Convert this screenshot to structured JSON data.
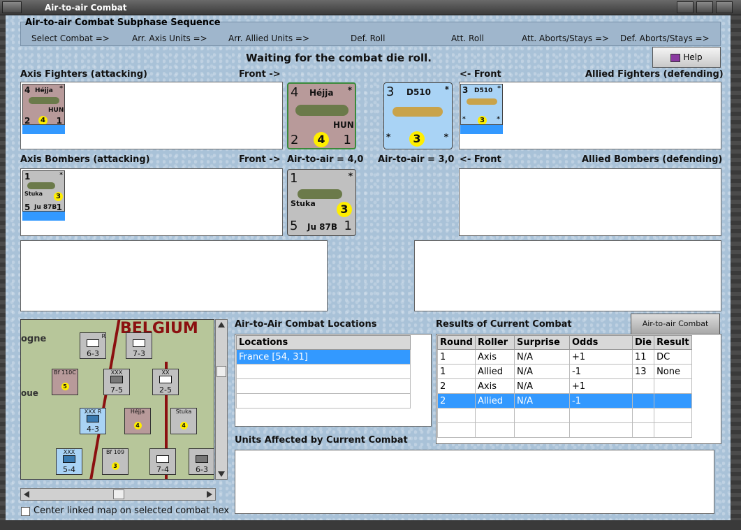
{
  "window": {
    "title": "Air-to-air Combat"
  },
  "phase": {
    "title": "Air-to-air Combat Subphase Sequence",
    "steps": [
      "Select Combat =>",
      "Arr. Axis Units =>",
      "Arr. Allied Units =>",
      "Def. Roll",
      "Att. Roll",
      "Att. Aborts/Stays =>",
      "Def. Aborts/Stays =>"
    ]
  },
  "status": "Waiting for the combat die roll.",
  "help_label": "Help",
  "labels": {
    "axis_fighters": "Axis Fighters (attacking)",
    "axis_bombers": "Axis Bombers (attacking)",
    "allied_fighters": "Allied Fighters (defending)",
    "allied_bombers": "Allied Bombers (defending)",
    "front_right": "Front ->",
    "front_left": "<- Front",
    "axis_air": "Air-to-air = 4,0",
    "allied_air": "Air-to-air = 3,0"
  },
  "counters": {
    "hejja": {
      "tl": "4",
      "name": "Héjja",
      "tr": "*",
      "nat": "HUN",
      "bl": "2",
      "mod": "4",
      "br": "1",
      "color": "#b89a9a"
    },
    "d510": {
      "tl": "3",
      "name": "D510",
      "tr": "*",
      "bl": "*",
      "mod": "3",
      "br": "*",
      "color": "#a9d3f5"
    },
    "stuka": {
      "tl": "1",
      "name": "Stuka",
      "tr": "*",
      "bl": "5",
      "type": "Ju 87B",
      "mod": "3",
      "br": "1",
      "color": "#c0c0c0"
    }
  },
  "locations": {
    "title": "Air-to-Air Combat Locations",
    "header": "Locations",
    "items": [
      "France [54, 31]"
    ]
  },
  "results": {
    "title": "Results of Current Combat",
    "chart_button": "Air-to-air Combat Chart",
    "columns": [
      "Round",
      "Roller",
      "Surprise",
      "Odds",
      "Die",
      "Result"
    ],
    "rows": [
      [
        "1",
        "Axis",
        "N/A",
        "+1",
        "11",
        "DC"
      ],
      [
        "1",
        "Allied",
        "N/A",
        "-1",
        "13",
        "None"
      ],
      [
        "2",
        "Axis",
        "N/A",
        "+1",
        "",
        ""
      ],
      [
        "2",
        "Allied",
        "N/A",
        "-1",
        "",
        ""
      ]
    ]
  },
  "units_affected_title": "Units Affected by Current Combat",
  "map": {
    "label_belgium": "BELGIUM",
    "label_ogne": "ogne",
    "label_oue": "oue",
    "units": [
      {
        "top": "R",
        "val": "6-3",
        "color": "#c0c0c0"
      },
      {
        "top": "",
        "val": "7-3",
        "color": "#c0c0c0"
      },
      {
        "top": "XXX",
        "val": "7-5",
        "color": "#c0c0c0"
      },
      {
        "top": "XX",
        "val": "2-5",
        "color": "#c0c0c0"
      },
      {
        "top": "XXX R",
        "val": "4-3",
        "color": "#a9d3f5"
      },
      {
        "top": "XXX",
        "val": "5-4",
        "color": "#a9d3f5"
      },
      {
        "top": "",
        "val": "7-4",
        "color": "#c0c0c0"
      },
      {
        "top": "",
        "val": "6-3",
        "color": "#c0c0c0"
      }
    ],
    "air_units": [
      {
        "name": "Bf 110C",
        "mod": "5"
      },
      {
        "name": "Héjja",
        "mod": "4"
      },
      {
        "name": "Stuka",
        "mod": "4"
      },
      {
        "name": "Bf 109",
        "mod": "3"
      }
    ]
  },
  "center_map_label": "Center linked map on selected combat hex"
}
